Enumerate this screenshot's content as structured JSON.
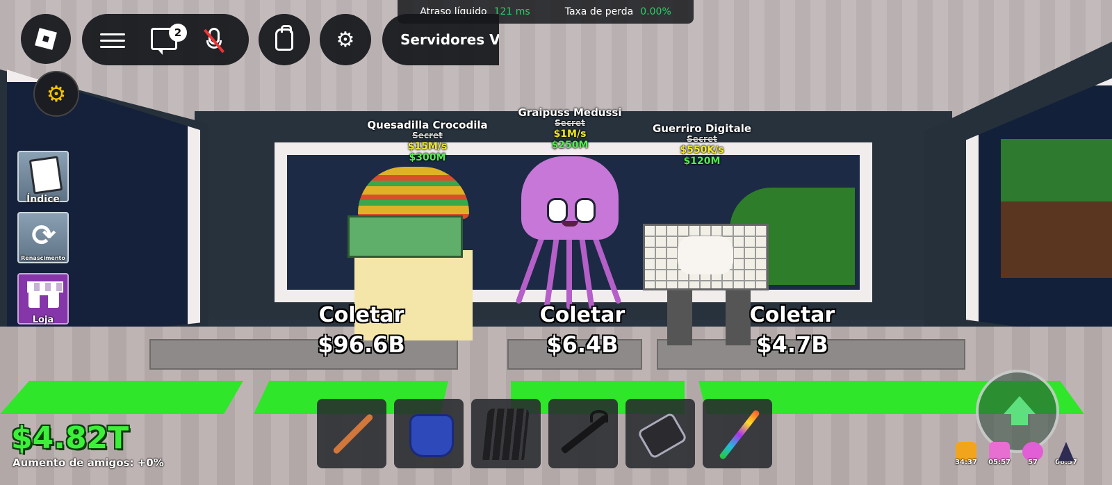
{
  "network": {
    "latency_label": "Atraso líquido",
    "latency_value": "121 ms",
    "loss_label": "Taxa de perda",
    "loss_value": "0.00%"
  },
  "topbar": {
    "chat_badge": "2",
    "servers_label": "Servidores VC"
  },
  "side_menu": {
    "index_label": "Índice",
    "rebirth_label": "Renascimento",
    "shop_label": "Loja"
  },
  "brainrots": [
    {
      "name": "Quesadilla Crocodila",
      "rarity": "Secret",
      "rate": "$15M/s",
      "price": "$300M",
      "collect_label": "Coletar",
      "collect_amount": "$96.6B"
    },
    {
      "name": "Graipuss Medussi",
      "rarity": "Secret",
      "rate": "$1M/s",
      "price": "$250M",
      "collect_label": "Coletar",
      "collect_amount": "$6.4B"
    },
    {
      "name": "Guerriro Digitale",
      "rarity": "Secret",
      "rate": "$550K/s",
      "price": "$120M",
      "collect_label": "Coletar",
      "collect_amount": "$4.7B"
    }
  ],
  "player": {
    "money": "$4.82T",
    "friends_boost": "Aumento de amigos: +0%"
  },
  "hotbar": {
    "items": [
      "bat-icon",
      "glove-icon",
      "cape-icon",
      "grapple-hook-icon",
      "gun-icon",
      "rainbow-wand-icon"
    ]
  },
  "buffs": [
    {
      "icon": "fire-buff-icon",
      "time": "34:37",
      "color": "#f2a51c"
    },
    {
      "icon": "gift-buff-icon",
      "time": "05:57",
      "color": "#e86fd2"
    },
    {
      "icon": "orb-buff-icon",
      "time": "57",
      "color": "#e25ed6"
    },
    {
      "icon": "wizard-buff-icon",
      "time": "06:57",
      "color": "#2e2c52"
    }
  ],
  "colors": {
    "money_green": "#3cf03a",
    "rate_yellow": "#f2ea2b",
    "price_green": "#52f04f",
    "net_value_green": "#2ad06a",
    "floor_green": "#2fe62a"
  }
}
